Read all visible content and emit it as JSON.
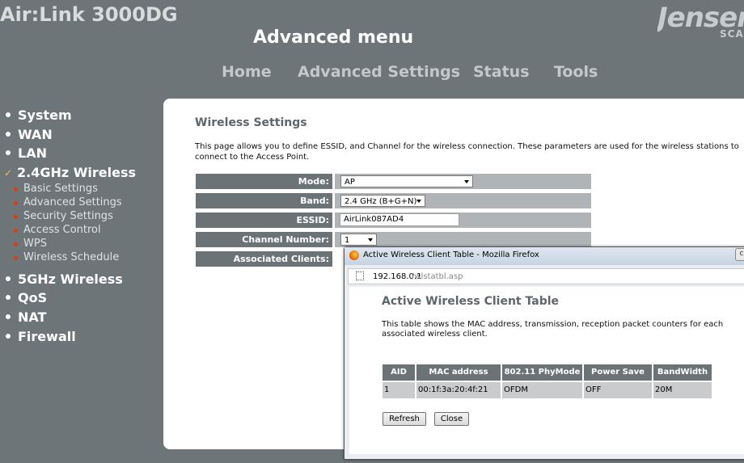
{
  "header": {
    "brand": "Air:Link 3000DG",
    "page_title": "Advanced menu",
    "logo_text": "Jensen",
    "logo_subtext": "SCA"
  },
  "topnav": [
    "Home",
    "Advanced Settings",
    "Status",
    "Tools"
  ],
  "sidebar": {
    "sections": [
      {
        "label": "System",
        "active": false
      },
      {
        "label": "WAN",
        "active": false
      },
      {
        "label": "LAN",
        "active": false
      },
      {
        "label": "2.4GHz Wireless",
        "active": true,
        "children": [
          "Basic Settings",
          "Advanced Settings",
          "Security Settings",
          "Access Control",
          "WPS",
          "Wireless Schedule"
        ]
      },
      {
        "label": "5GHz Wireless",
        "active": false
      },
      {
        "label": "QoS",
        "active": false
      },
      {
        "label": "NAT",
        "active": false
      },
      {
        "label": "Firewall",
        "active": false
      }
    ]
  },
  "wireless": {
    "title": "Wireless Settings",
    "description": "This page allows you to define ESSID, and Channel for the wireless connection. These parameters are used for the wireless stations to connect to the Access Point.",
    "mode_label": "Mode:",
    "mode_value": "AP",
    "band_label": "Band:",
    "band_value": "2.4 GHz (B+G+N)",
    "essid_label": "ESSID:",
    "essid_value": "AirLink087AD4",
    "channel_label": "Channel Number:",
    "channel_value": "1",
    "clients_label": "Associated Clients:"
  },
  "popup": {
    "window_title": "Active Wireless Client Table - Mozilla Firefox",
    "close_glyph": "c",
    "url_host": "192.168.0.1",
    "url_path": "/wlstatbl.asp",
    "title": "Active Wireless Client Table",
    "description": "This table shows the MAC address, transmission, reception packet counters for each associated wireless client.",
    "columns": [
      "AID",
      "MAC address",
      "802.11 PhyMode",
      "Power Save",
      "BandWidth"
    ],
    "rows": [
      [
        "1",
        "00:1f:3a:20:4f:21",
        "OFDM",
        "OFF",
        "20M"
      ]
    ],
    "refresh_label": "Refresh",
    "close_label": "Close"
  }
}
